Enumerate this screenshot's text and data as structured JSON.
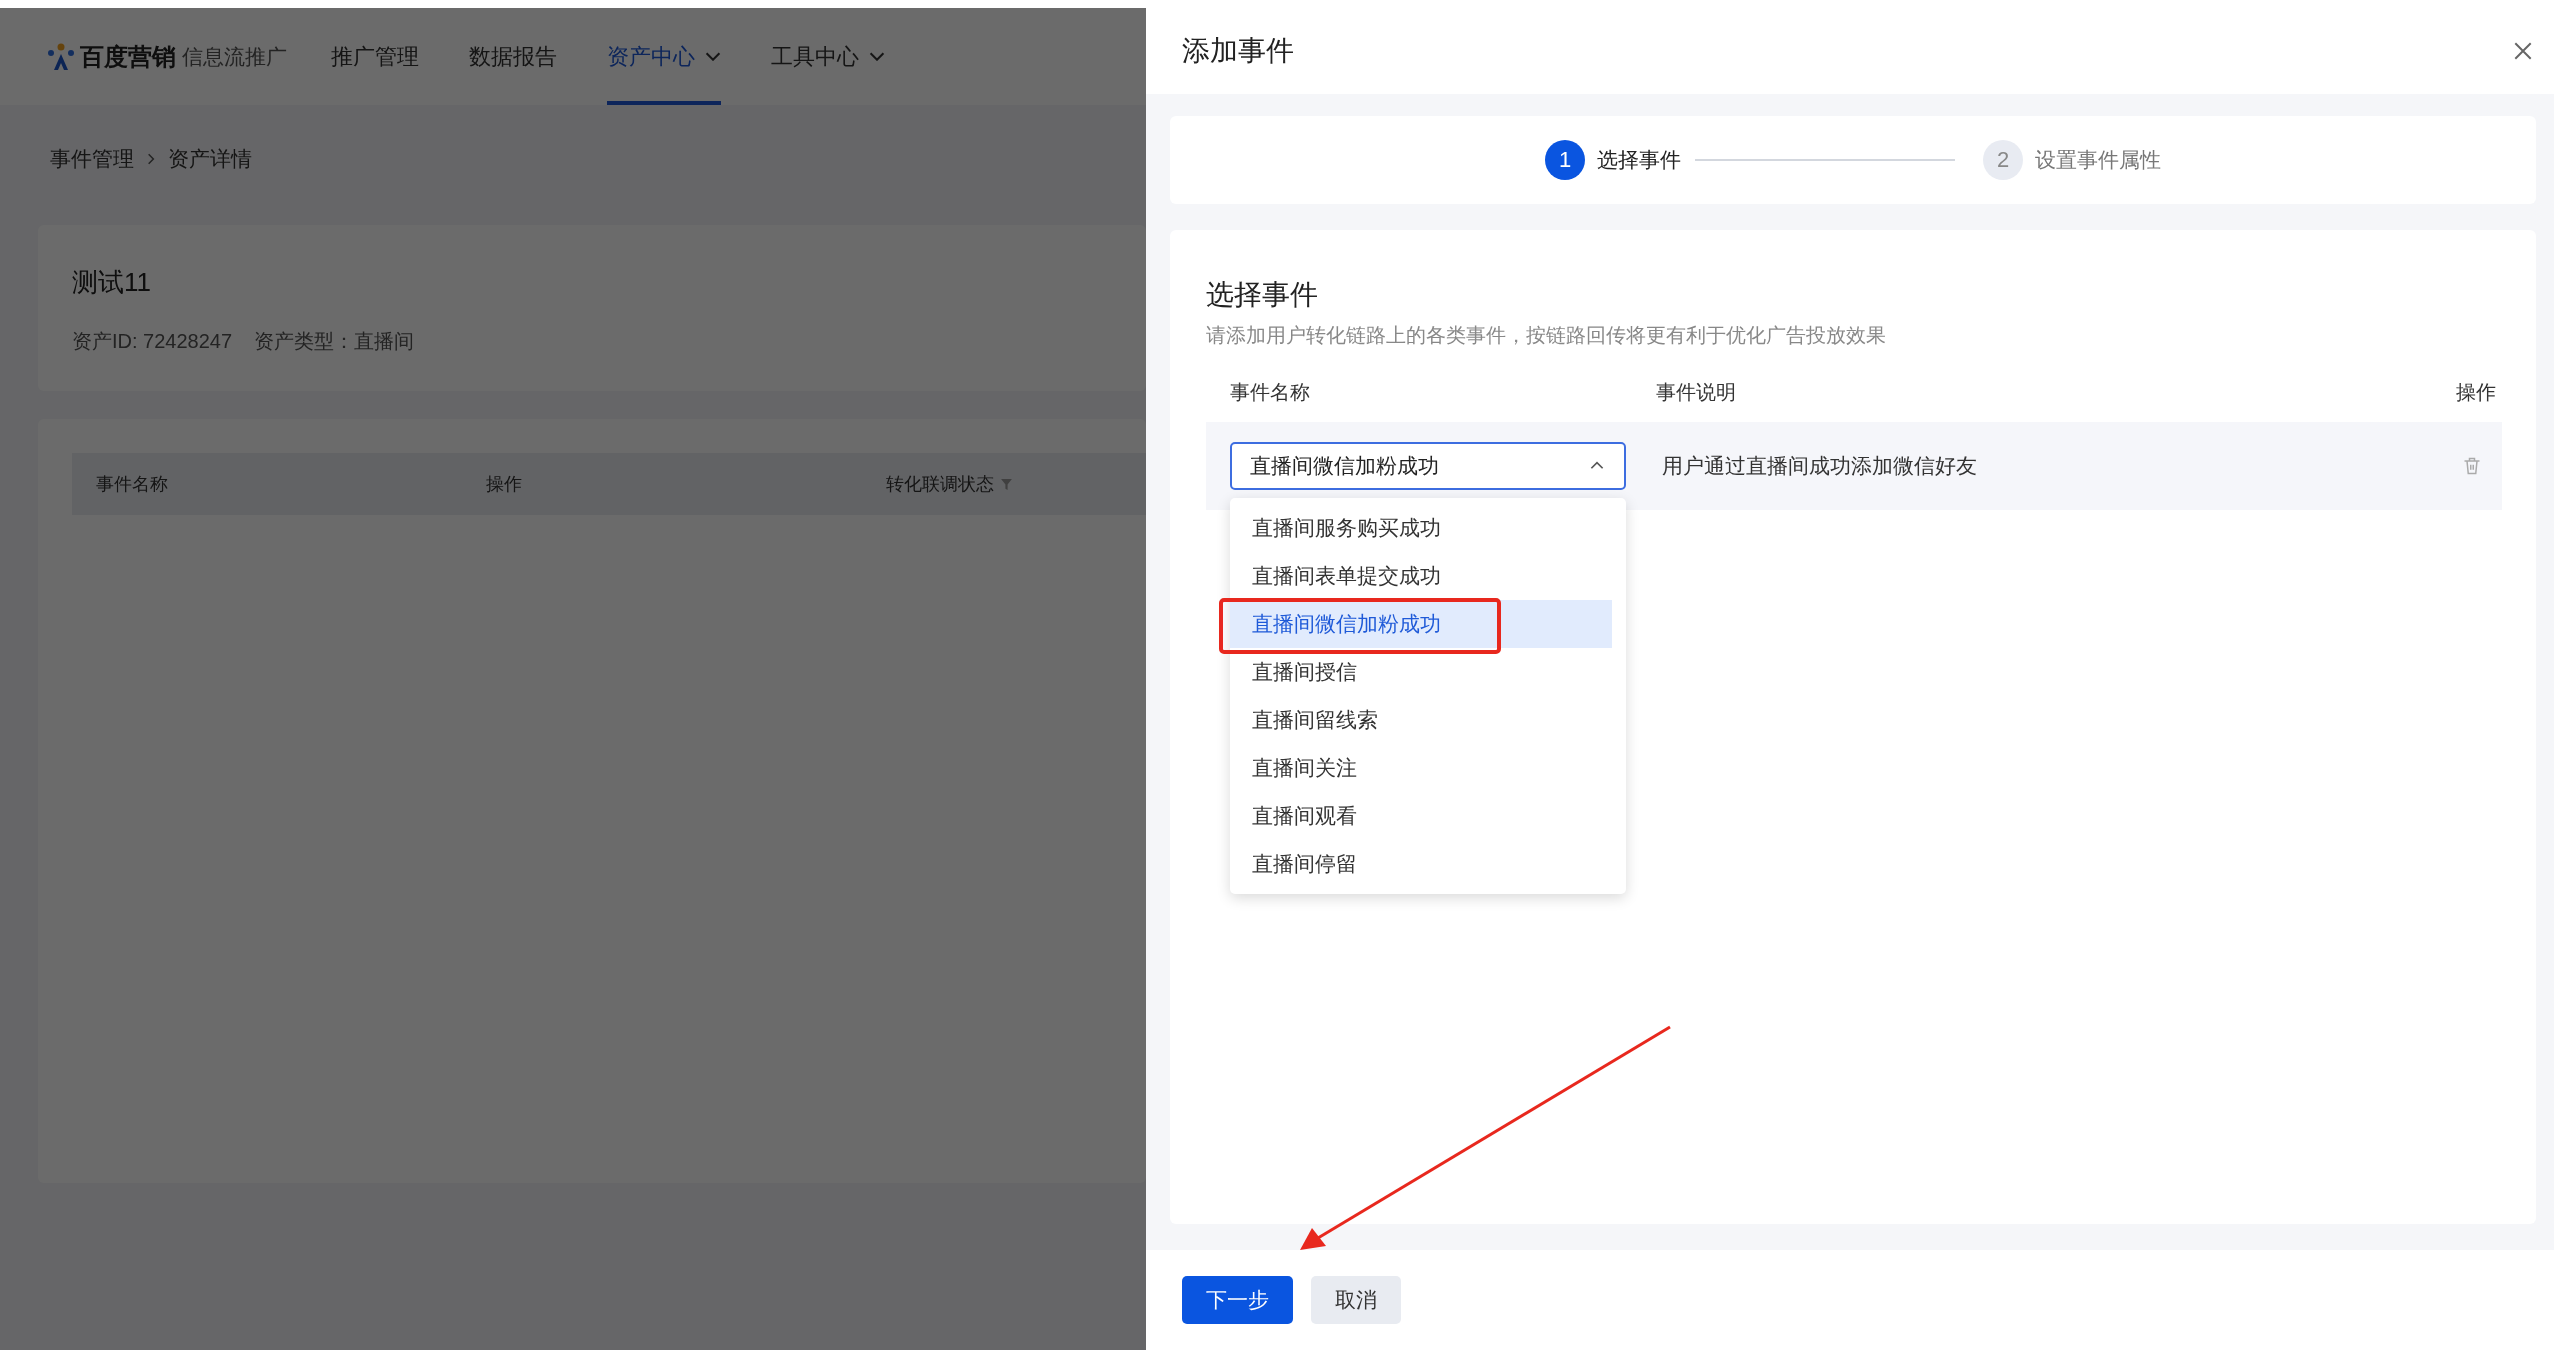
{
  "nav": {
    "logo": "百度营销",
    "product": "信息流推广",
    "items": [
      {
        "label": "推广管理",
        "selected": false,
        "dropdown": false
      },
      {
        "label": "数据报告",
        "selected": false,
        "dropdown": false
      },
      {
        "label": "资产中心",
        "selected": true,
        "dropdown": true
      },
      {
        "label": "工具中心",
        "selected": false,
        "dropdown": true
      }
    ]
  },
  "breadcrumb": [
    "事件管理",
    "资产详情"
  ],
  "asset": {
    "title": "测试11",
    "id_label": "资产ID: 72428247",
    "type_label": "资产类型：直播间"
  },
  "table": {
    "columns": [
      {
        "label": "事件名称",
        "filter": false
      },
      {
        "label": "操作",
        "filter": false
      },
      {
        "label": "转化联调状态",
        "filter": true
      }
    ]
  },
  "drawer": {
    "title": "添加事件",
    "steps": [
      {
        "number": "1",
        "label": "选择事件",
        "selected": true
      },
      {
        "number": "2",
        "label": "设置事件属性",
        "selected": false
      }
    ],
    "section_title": "选择事件",
    "description": "请添加用户转化链路上的各类事件，按链路回传将更有利于优化广告投放效果",
    "columns": [
      "事件名称",
      "事件说明",
      "操作"
    ],
    "row": {
      "value": "直播间微信加粉成功",
      "expanded": true,
      "description": "用户通过直播间成功添加微信好友"
    },
    "options": [
      {
        "label": "直播间服务购买成功",
        "selected": false
      },
      {
        "label": "直播间表单提交成功",
        "selected": false
      },
      {
        "label": "直播间微信加粉成功",
        "selected": true
      },
      {
        "label": "直播间授信",
        "selected": false
      },
      {
        "label": "直播间留线索",
        "selected": false
      },
      {
        "label": "直播间关注",
        "selected": false
      },
      {
        "label": "直播间观看",
        "selected": false
      },
      {
        "label": "直播间停留",
        "selected": false
      }
    ],
    "buttons": [
      {
        "label": "下一步",
        "kind": "primary"
      },
      {
        "label": "取消",
        "kind": "default"
      }
    ]
  }
}
